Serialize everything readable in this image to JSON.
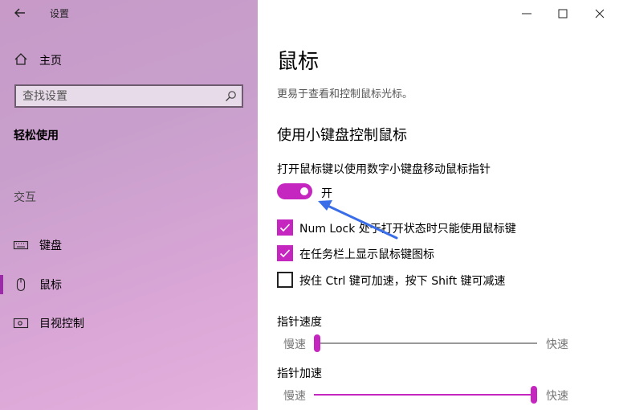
{
  "window": {
    "title": "设置",
    "back_icon": "back-arrow-icon",
    "controls": [
      "minimize-icon",
      "maximize-icon",
      "close-icon"
    ]
  },
  "sidebar": {
    "home_label": "主页",
    "search_placeholder": "查找设置",
    "section_title": "轻松使用",
    "group_label": "交互",
    "items": [
      {
        "label": "键盘",
        "icon": "keyboard-icon"
      },
      {
        "label": "鼠标",
        "icon": "mouse-icon",
        "active": true
      },
      {
        "label": "目视控制",
        "icon": "eye-control-icon"
      }
    ]
  },
  "main": {
    "title": "鼠标",
    "description": "更易于查看和控制鼠标光标。",
    "subheading": "使用小键盘控制鼠标",
    "mouse_keys_label": "打开鼠标键以使用数字小键盘移动鼠标指针",
    "mouse_keys_toggle": {
      "on": true,
      "state_label": "开"
    },
    "checkboxes": [
      {
        "label": "Num Lock 处于打开状态时只能使用鼠标键",
        "checked": true
      },
      {
        "label": "在任务栏上显示鼠标键图标",
        "checked": true
      },
      {
        "label": "按住 Ctrl 键可加速，按下 Shift 键可减速",
        "checked": false
      }
    ],
    "pointer_speed": {
      "label": "指针速度",
      "min_label": "慢速",
      "max_label": "快速",
      "value_fraction": 0.0
    },
    "pointer_acceleration": {
      "label": "指针加速",
      "min_label": "慢速",
      "max_label": "快速",
      "value_fraction": 1.0
    }
  },
  "colors": {
    "accent": "#c526c0",
    "annotation_arrow": "#3a6ee8"
  }
}
